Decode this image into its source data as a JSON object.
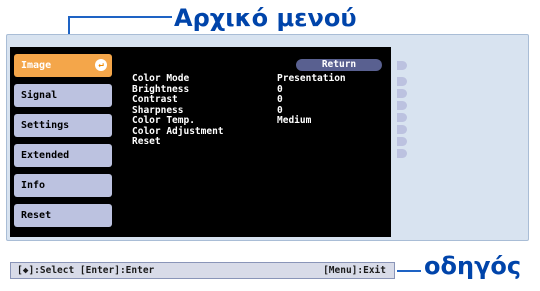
{
  "callouts": {
    "top_menu": "Αρχικό μενού",
    "guide": "οδηγός"
  },
  "sidebar": {
    "items": [
      {
        "label": "Image",
        "active": true
      },
      {
        "label": "Signal",
        "active": false
      },
      {
        "label": "Settings",
        "active": false
      },
      {
        "label": "Extended",
        "active": false
      },
      {
        "label": "Info",
        "active": false
      },
      {
        "label": "Reset",
        "active": false
      }
    ]
  },
  "submenu": {
    "return_label": "Return",
    "rows": [
      {
        "label": "Color Mode",
        "value": "Presentation"
      },
      {
        "label": "Brightness",
        "value": "0"
      },
      {
        "label": "Contrast",
        "value": "0"
      },
      {
        "label": "Sharpness",
        "value": "0"
      },
      {
        "label": "Color Temp.",
        "value": "Medium"
      },
      {
        "label": "Color Adjustment",
        "value": ""
      },
      {
        "label": "Reset",
        "value": ""
      }
    ]
  },
  "status_bar": {
    "left": "[◆]:Select [Enter]:Enter",
    "right": "[Menu]:Exit"
  },
  "colors": {
    "accent": "#f4a64a",
    "callout_text": "#0044aa",
    "callout_line": "#1e63c4"
  }
}
